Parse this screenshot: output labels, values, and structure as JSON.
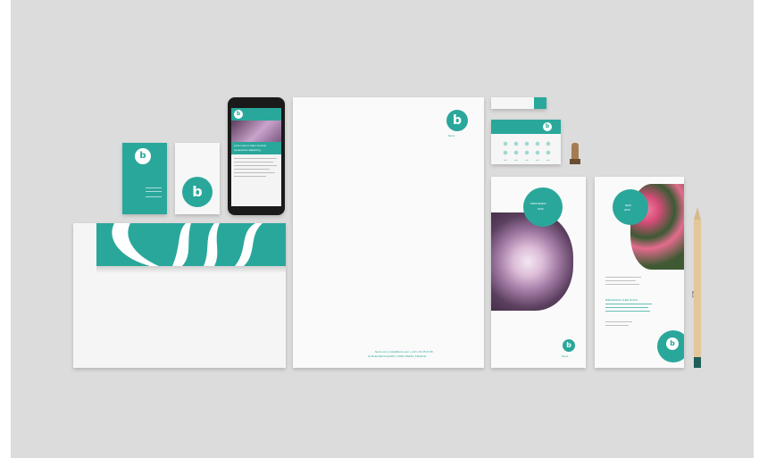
{
  "brand": {
    "mark": "b",
    "name": "fleurs",
    "accent_color": "#2aa79b",
    "background_color": "#dcdcdc"
  },
  "phone": {
    "heading": "Lorem ipsum dolor sit amet",
    "subheading": "consectetur adipiscing"
  },
  "rack_card_1": {
    "badge_line_1": "PRINTEMPS",
    "badge_line_2": "2015"
  },
  "rack_card_2": {
    "badge_line_1": "NEW",
    "badge_line_2": "2015",
    "body_heading": "BIENVENUE CHEZ NOUS"
  },
  "letterhead": {
    "footer_line_1": "fleurs.com  |  info@fleurs.com  |  +33 1 23 45 67 89",
    "footer_line_2": "12 RUE DES FLEURS  |  75001 PARIS  |  FRANCE"
  },
  "pencil": {
    "label": "fleurs"
  }
}
